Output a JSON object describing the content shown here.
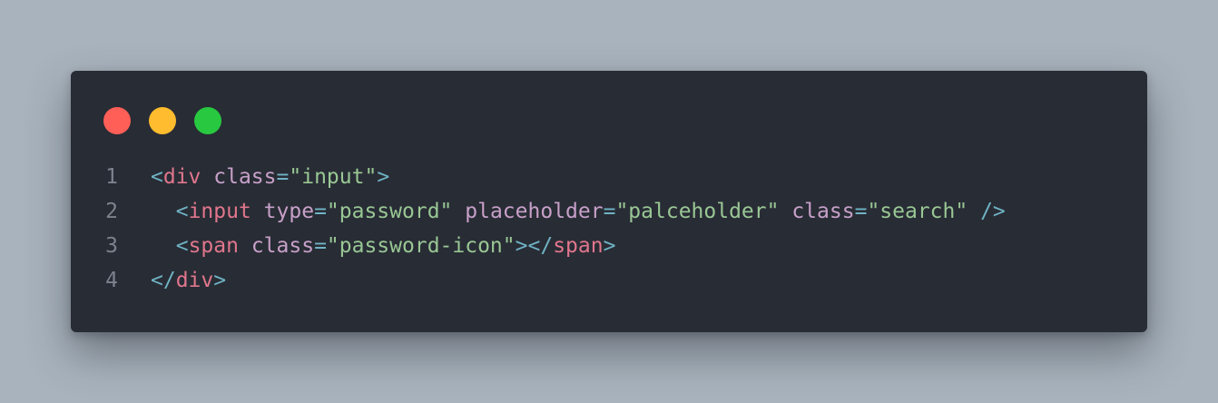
{
  "window": {
    "controls": [
      {
        "name": "close",
        "color": "#ff5f57"
      },
      {
        "name": "minimize",
        "color": "#febc2e"
      },
      {
        "name": "zoom",
        "color": "#28c840"
      }
    ]
  },
  "code": {
    "lines": [
      {
        "number": "1",
        "tokens": [
          {
            "t": "<",
            "k": "punct"
          },
          {
            "t": "div",
            "k": "tag"
          },
          {
            "t": " ",
            "k": "plain"
          },
          {
            "t": "class",
            "k": "attr"
          },
          {
            "t": "=",
            "k": "punct"
          },
          {
            "t": "\"input\"",
            "k": "str"
          },
          {
            "t": ">",
            "k": "punct"
          }
        ]
      },
      {
        "number": "2",
        "tokens": [
          {
            "t": "  ",
            "k": "plain"
          },
          {
            "t": "<",
            "k": "punct"
          },
          {
            "t": "input",
            "k": "tag"
          },
          {
            "t": " ",
            "k": "plain"
          },
          {
            "t": "type",
            "k": "attr"
          },
          {
            "t": "=",
            "k": "punct"
          },
          {
            "t": "\"password\"",
            "k": "str"
          },
          {
            "t": " ",
            "k": "plain"
          },
          {
            "t": "placeholder",
            "k": "attr"
          },
          {
            "t": "=",
            "k": "punct"
          },
          {
            "t": "\"palceholder\"",
            "k": "str"
          },
          {
            "t": " ",
            "k": "plain"
          },
          {
            "t": "class",
            "k": "attr"
          },
          {
            "t": "=",
            "k": "punct"
          },
          {
            "t": "\"search\"",
            "k": "str"
          },
          {
            "t": " ",
            "k": "plain"
          },
          {
            "t": "/>",
            "k": "punct"
          }
        ]
      },
      {
        "number": "3",
        "tokens": [
          {
            "t": "  ",
            "k": "plain"
          },
          {
            "t": "<",
            "k": "punct"
          },
          {
            "t": "span",
            "k": "tag"
          },
          {
            "t": " ",
            "k": "plain"
          },
          {
            "t": "class",
            "k": "attr"
          },
          {
            "t": "=",
            "k": "punct"
          },
          {
            "t": "\"password-icon\"",
            "k": "str"
          },
          {
            "t": "></",
            "k": "punct"
          },
          {
            "t": "span",
            "k": "tag"
          },
          {
            "t": ">",
            "k": "punct"
          }
        ]
      },
      {
        "number": "4",
        "tokens": [
          {
            "t": "</",
            "k": "punct"
          },
          {
            "t": "div",
            "k": "tag"
          },
          {
            "t": ">",
            "k": "punct"
          }
        ]
      }
    ]
  },
  "colors": {
    "background": "#a9b3bd",
    "editor": "#282c35",
    "line_number": "#7c828d",
    "punct": "#6fb3c4",
    "tag": "#e0768c",
    "attr": "#c7a0c8",
    "string": "#99c794"
  }
}
